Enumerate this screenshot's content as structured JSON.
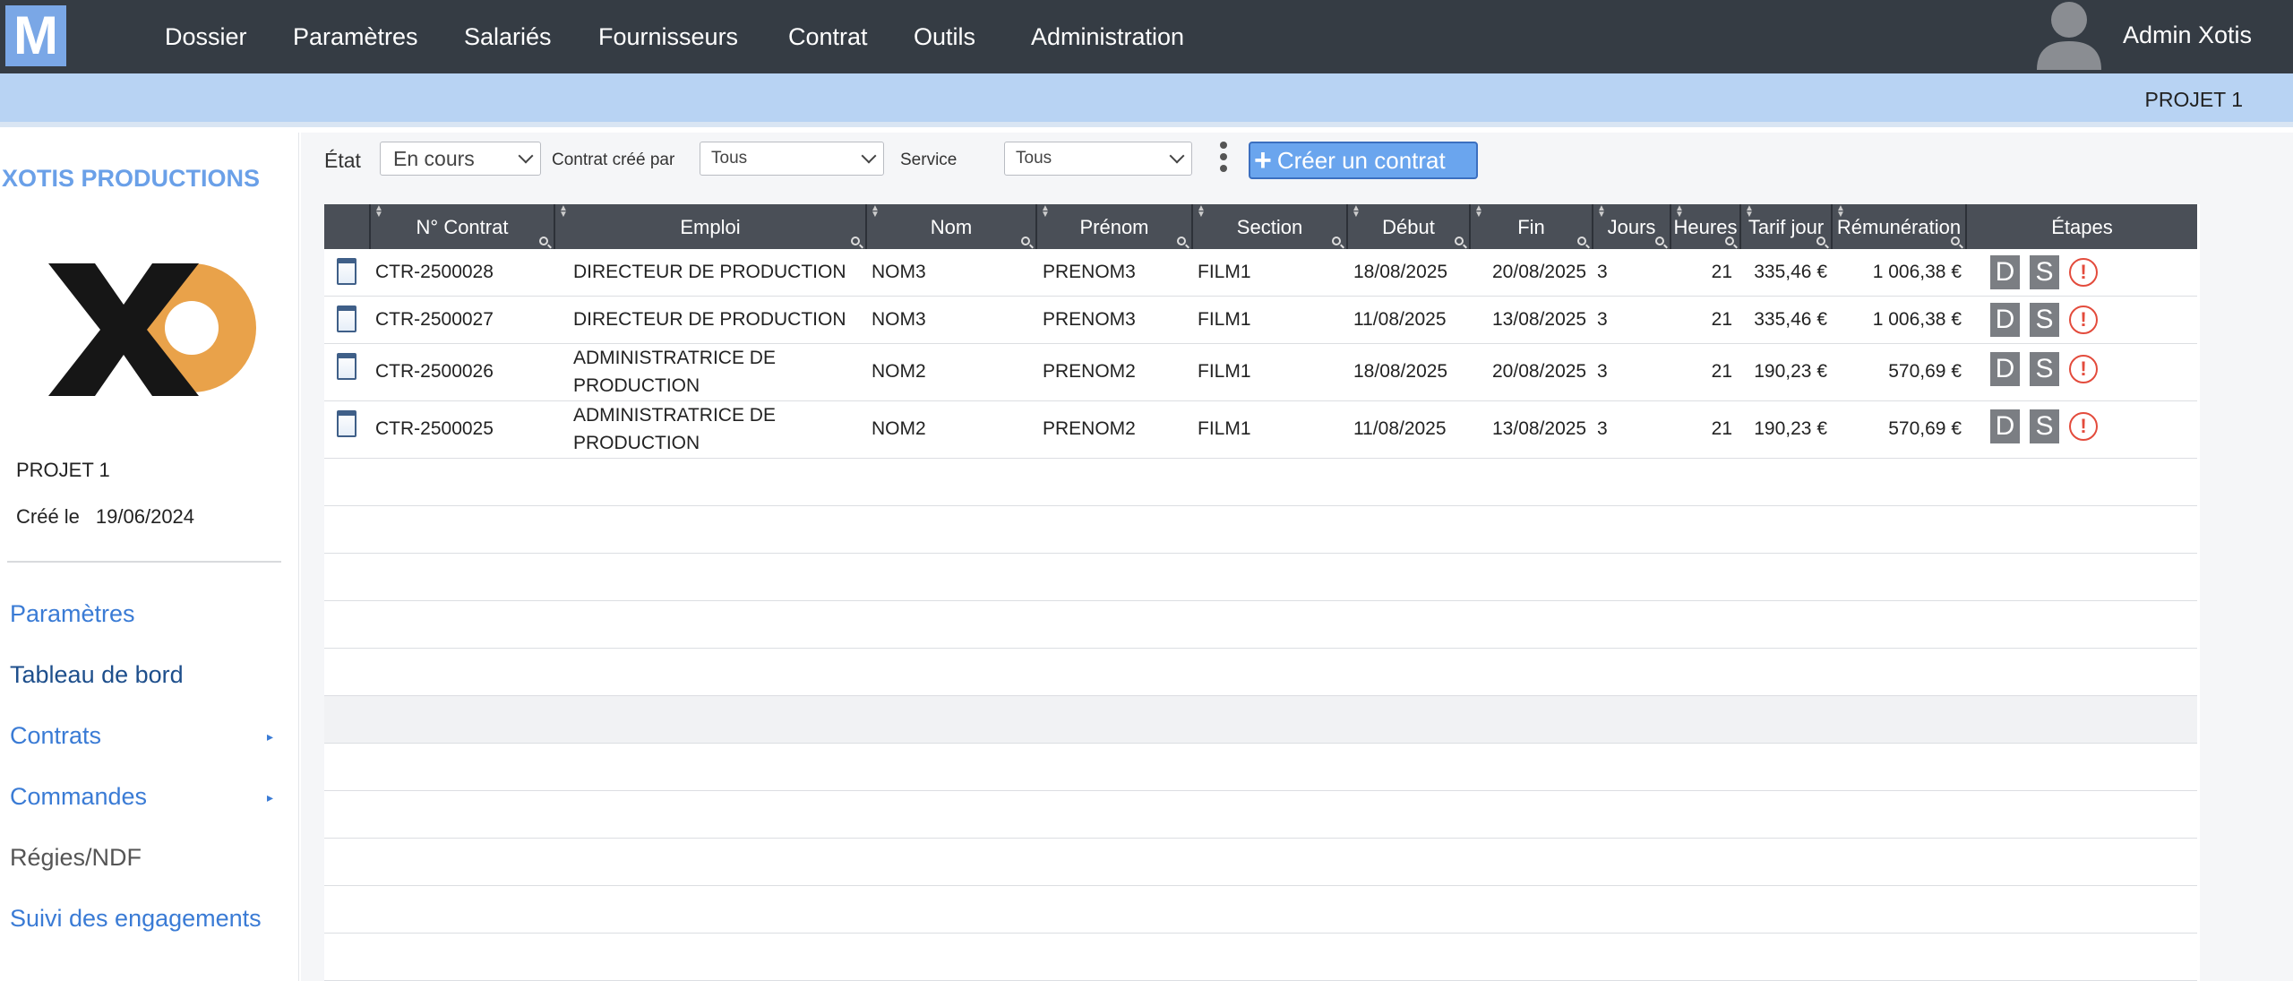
{
  "app": {
    "logo_letter": "M"
  },
  "nav": {
    "items": [
      "Dossier",
      "Paramètres",
      "Salariés",
      "Fournisseurs",
      "Contrat",
      "Outils",
      "Administration"
    ],
    "user_name": "Admin Xotis"
  },
  "subbar": {
    "project": "PROJET 1"
  },
  "sidebar": {
    "company": "XOTIS PRODUCTIONS",
    "project": "PROJET 1",
    "created_label": "Créé le",
    "created_date": "19/06/2024",
    "links": [
      "Paramètres",
      "Tableau de bord",
      "Contrats",
      "Commandes",
      "Régies/NDF",
      "Suivi des engagements"
    ],
    "colors": {
      "link": "#3a7bd5",
      "active": "#1e4f8c",
      "muted": "#555555"
    }
  },
  "filters": {
    "etat_label": "État",
    "etat_value": "En cours",
    "cree_par_label": "Contrat créé par",
    "cree_par_value": "Tous",
    "service_label": "Service",
    "service_value": "Tous",
    "create_button": "Créer un contrat"
  },
  "table": {
    "headers": [
      "N° Contrat",
      "Emploi",
      "Nom",
      "Prénom",
      "Section",
      "Début",
      "Fin",
      "Jours",
      "Heures",
      "Tarif jour",
      "Rémunération",
      "Étapes"
    ],
    "rows": [
      {
        "num": "CTR-2500028",
        "emploi": "DIRECTEUR DE PRODUCTION",
        "nom": "NOM3",
        "prenom": "PRENOM3",
        "section": "FILM1",
        "debut": "18/08/2025",
        "fin": "20/08/2025",
        "jours": "3",
        "heures": "21",
        "tarif": "335,46 €",
        "remu": "1 006,38 €",
        "step_d": "D",
        "step_s": "S",
        "warn": "!"
      },
      {
        "num": "CTR-2500027",
        "emploi": "DIRECTEUR DE PRODUCTION",
        "nom": "NOM3",
        "prenom": "PRENOM3",
        "section": "FILM1",
        "debut": "11/08/2025",
        "fin": "13/08/2025",
        "jours": "3",
        "heures": "21",
        "tarif": "335,46 €",
        "remu": "1 006,38 €",
        "step_d": "D",
        "step_s": "S",
        "warn": "!"
      },
      {
        "num": "CTR-2500026",
        "emploi": "ADMINISTRATRICE DE PRODUCTION",
        "nom": "NOM2",
        "prenom": "PRENOM2",
        "section": "FILM1",
        "debut": "18/08/2025",
        "fin": "20/08/2025",
        "jours": "3",
        "heures": "21",
        "tarif": "190,23 €",
        "remu": "570,69 €",
        "step_d": "D",
        "step_s": "S",
        "warn": "!"
      },
      {
        "num": "CTR-2500025",
        "emploi": "ADMINISTRATRICE DE PRODUCTION",
        "nom": "NOM2",
        "prenom": "PRENOM2",
        "section": "FILM1",
        "debut": "11/08/2025",
        "fin": "13/08/2025",
        "jours": "3",
        "heures": "21",
        "tarif": "190,23 €",
        "remu": "570,69 €",
        "step_d": "D",
        "step_s": "S",
        "warn": "!"
      }
    ],
    "icons": {
      "row_icon": "document-icon",
      "sort_icon": "sort-icon",
      "filter_icon": "search-icon",
      "warning_icon": "warning-icon"
    }
  }
}
